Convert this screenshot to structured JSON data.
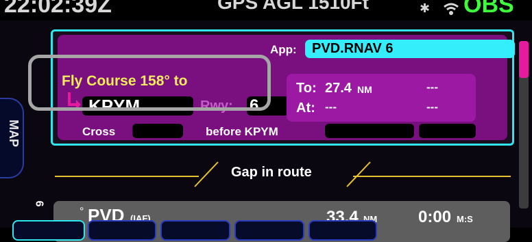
{
  "status_bar": {
    "time": "22:02:39Z",
    "gps_agl": "GPS AGL 1510Ft",
    "mode": "OBS"
  },
  "side_tab": {
    "label": "MAP"
  },
  "instruction": {
    "app_label": "App:",
    "app_value": "PVD.RNAV 6",
    "fly_course": "Fly Course 158° to",
    "waypoint": "KPYM",
    "rwy_label": "Rwy:",
    "rwy_value": "6",
    "to_label": "To:",
    "to_value": "27.4",
    "to_unit": "NM",
    "to_extra": "---",
    "at_label": "At:",
    "at_value1": "---",
    "at_value2": "---",
    "cross_label": "Cross",
    "before_label": "before KPYM"
  },
  "route": {
    "gap_text": "Gap in route"
  },
  "next_waypoint": {
    "name": "PVD",
    "tag": "(IAF)",
    "distance": "33.4",
    "distance_unit": "NM",
    "time": "0:00",
    "time_unit": "M:S",
    "side_badge": "6"
  },
  "colors": {
    "accent_cyan": "#2ee6ee",
    "panel_magenta": "#7a0f80",
    "text_yellow": "#f4ec5a",
    "highlight_gray": "#a6a6a6",
    "mode_green": "#3cff3c"
  }
}
